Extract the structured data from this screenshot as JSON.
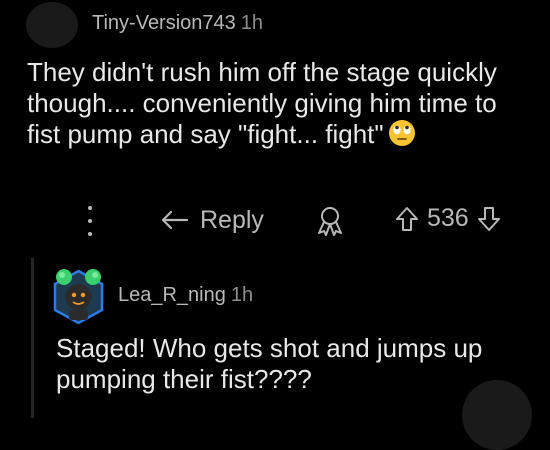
{
  "comment": {
    "author": "Tiny-Version743",
    "time": "1h",
    "text": "They didn't rush him off the stage quickly though.... conveniently giving him time to fist pump and say \"fight... fight\"",
    "emoji": "face-with-rolling-eyes"
  },
  "actions": {
    "reply_label": "Reply",
    "vote_count": "536"
  },
  "reply": {
    "author": "Lea_R_ning",
    "time": "1h",
    "text": "Staged! Who gets shot and jumps up pumping their fist????"
  },
  "colors": {
    "background": "#000000",
    "text": "#e8e8e8",
    "muted": "#b8b8b8",
    "avatar_border": "#2c7be5",
    "avatar_accent": "#3ccf6e"
  }
}
